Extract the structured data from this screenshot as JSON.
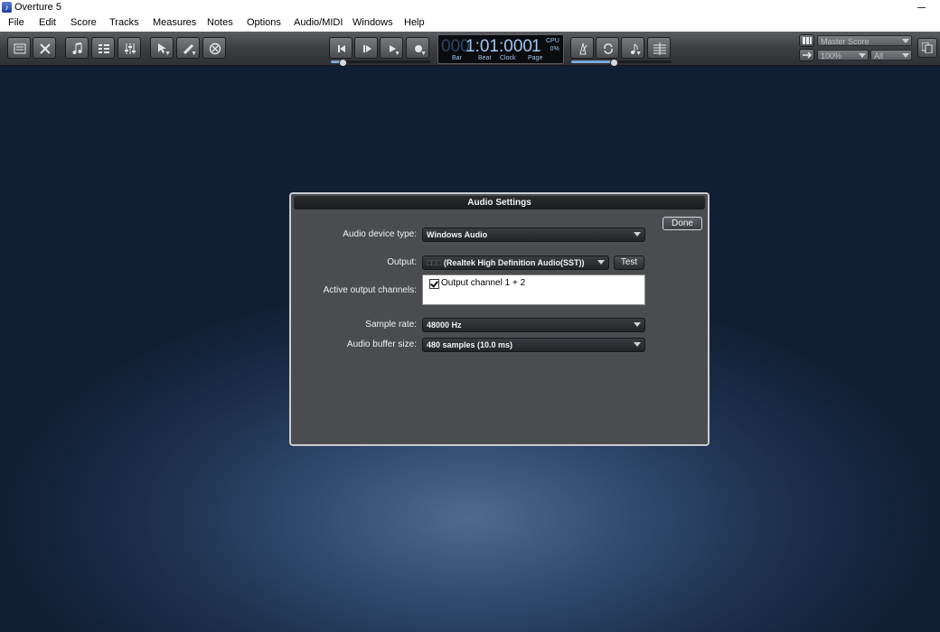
{
  "window": {
    "title": "Overture 5"
  },
  "menu": [
    "File",
    "Edit",
    "Score",
    "Tracks",
    "Measures",
    "Notes",
    "Options",
    "Audio/MIDI",
    "Windows",
    "Help"
  ],
  "transport": {
    "bar_display": "000",
    "position": "1:01:000",
    "page": "1",
    "cpu_label": "CPU",
    "cpu_value": "0%",
    "labels": {
      "bar": "Bar",
      "beat": "Beat",
      "clock": "Clock",
      "page": "Page"
    }
  },
  "score_panel": {
    "score_select": "Master Score",
    "zoom": "100%",
    "view": "All"
  },
  "dialog": {
    "title": "Audio Settings",
    "done_label": "Done",
    "device_type_label": "Audio device type:",
    "device_type_value": "Windows Audio",
    "output_label": "Output:",
    "output_prefix": "□□□",
    "output_value": "(Realtek High Definition Audio(SST))",
    "test_label": "Test",
    "channels_label": "Active output channels:",
    "channels": [
      {
        "label": "Output channel 1 + 2",
        "checked": true
      }
    ],
    "sample_rate_label": "Sample rate:",
    "sample_rate_value": "48000 Hz",
    "buffer_label": "Audio buffer size:",
    "buffer_value": "480 samples (10.0 ms)"
  }
}
